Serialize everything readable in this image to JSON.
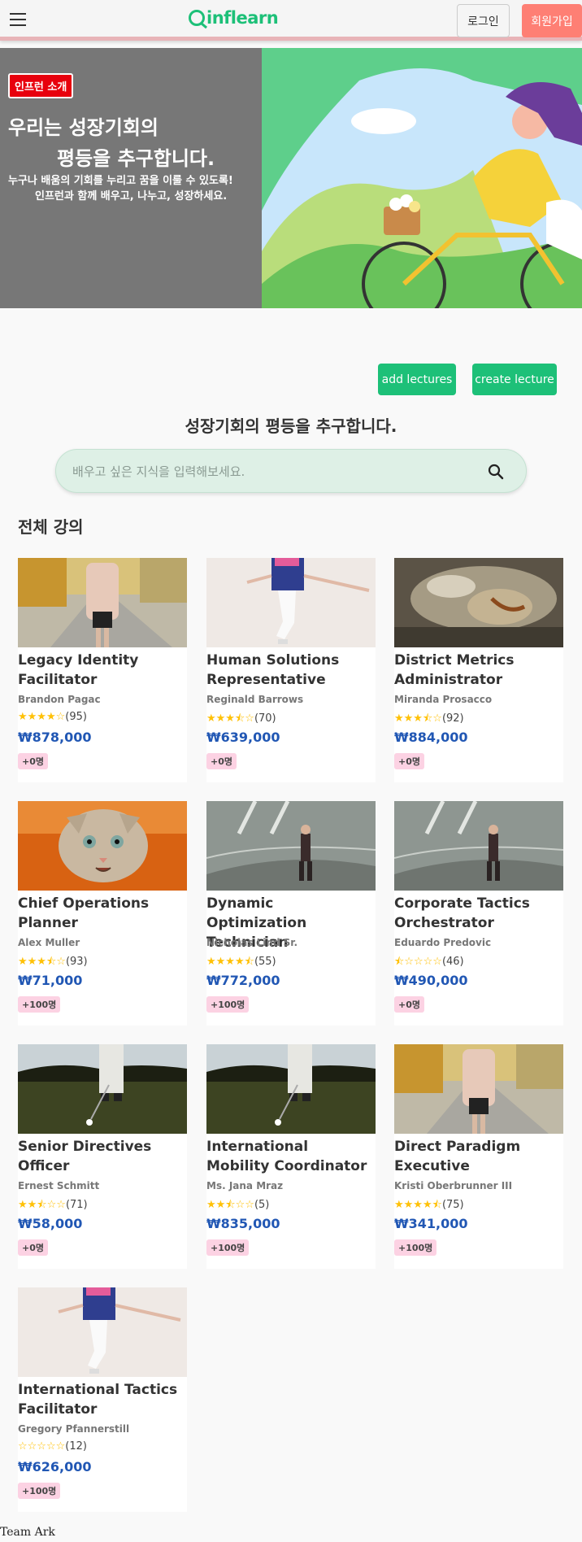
{
  "header": {
    "logo_text": "inflearn",
    "login_label": "로그인",
    "signup_label": "회원가입",
    "brand_color": "#1dc078",
    "signup_color": "#fe7f74"
  },
  "hero": {
    "badge": "인프런 소개",
    "title_line1": "우리는 성장기회의",
    "title_line2": "평등을 추구합니다.",
    "sub_line1": "누구나 배움의 기회를 누리고 꿈을 이룰 수 있도록!",
    "sub_line2": "인프런과 함께 배우고, 나누고, 성장하세요."
  },
  "actions": {
    "add_label": "add lectures",
    "create_label": "create lecture"
  },
  "slogan": "성장기회의 평등을 추구합니다.",
  "search": {
    "placeholder": "배우고 싶은 지식을 입력해보세요.",
    "icon": "search-icon"
  },
  "section_title": "전체 강의",
  "courses": [
    {
      "title": "Legacy Identity Facilitator",
      "author": "Brandon Pagac",
      "stars": "★★★★☆",
      "count": "(95)",
      "price": "₩878,000",
      "badge": "+0명",
      "thumb": "woman-street"
    },
    {
      "title": "Human Solutions Representative",
      "author": "Reginald Barrows",
      "stars": "★★★⯪☆",
      "count": "(70)",
      "price": "₩639,000",
      "badge": "+0명",
      "thumb": "jumping-woman"
    },
    {
      "title": "District Metrics Administrator",
      "author": "Miranda Prosacco",
      "stars": "★★★⯪☆",
      "count": "(92)",
      "price": "₩884,000",
      "badge": "+0명",
      "thumb": "rock"
    },
    {
      "title": "Chief Operations Planner",
      "author": "Alex Muller",
      "stars": "★★★⯪☆",
      "count": "(93)",
      "price": "₩71,000",
      "badge": "+100명",
      "thumb": "cat"
    },
    {
      "title": "Dynamic Optimization Technician",
      "author": "Nicholas Lind Sr.",
      "stars": "★★★★⯪",
      "count": "(55)",
      "price": "₩772,000",
      "badge": "+100명",
      "thumb": "man-road"
    },
    {
      "title": "Corporate Tactics Orchestrator",
      "author": "Eduardo Predovic",
      "stars": "⯪☆☆☆☆",
      "count": "(46)",
      "price": "₩490,000",
      "badge": "+0명",
      "thumb": "man-road"
    },
    {
      "title": "Senior Directives Officer",
      "author": "Ernest Schmitt",
      "stars": "★★⯪☆☆",
      "count": "(71)",
      "price": "₩58,000",
      "badge": "+0명",
      "thumb": "golf"
    },
    {
      "title": "International Mobility Coordinator",
      "author": "Ms. Jana Mraz",
      "stars": "★★⯪☆☆",
      "count": "(5)",
      "price": "₩835,000",
      "badge": "+100명",
      "thumb": "golf"
    },
    {
      "title": "Direct Paradigm Executive",
      "author": "Kristi Oberbrunner III",
      "stars": "★★★★⯪",
      "count": "(75)",
      "price": "₩341,000",
      "badge": "+100명",
      "thumb": "woman-street"
    },
    {
      "title": "International Tactics Facilitator",
      "author": "Gregory Pfannerstill",
      "stars": "☆☆☆☆☆",
      "count": "(12)",
      "price": "₩626,000",
      "badge": "+100명",
      "thumb": "jumping-woman"
    }
  ],
  "footer": "Team Ark"
}
